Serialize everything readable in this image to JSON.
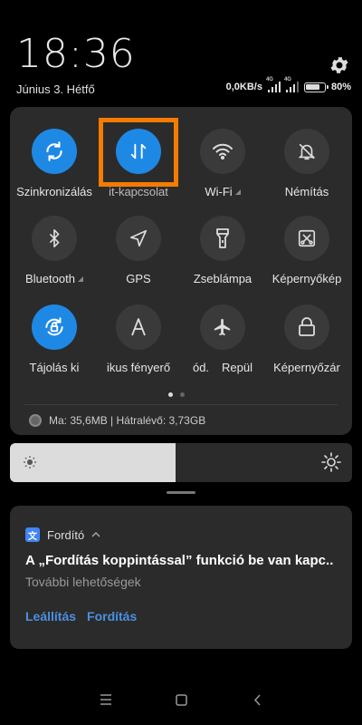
{
  "status": {
    "time": "18:36",
    "date": "Június 3. Hétfő",
    "net_speed": "0,0KB/s",
    "sim1_type": "4G",
    "sim2_type": "4G",
    "battery": "80%",
    "battery_level": 0.8
  },
  "quick_settings": {
    "tiles": [
      {
        "label": "Szinkronizálás",
        "icon": "sync-icon",
        "active": true,
        "expandable": false
      },
      {
        "label": "it-kapcsolat",
        "icon": "mobile-data-icon",
        "active": true,
        "expandable": false
      },
      {
        "label": "Wi-Fi",
        "icon": "wifi-icon",
        "active": false,
        "expandable": true
      },
      {
        "label": "Némítás",
        "icon": "mute-icon",
        "active": false,
        "expandable": false
      },
      {
        "label": "Bluetooth",
        "icon": "bluetooth-icon",
        "active": false,
        "expandable": true
      },
      {
        "label": "GPS",
        "icon": "gps-icon",
        "active": false,
        "expandable": false
      },
      {
        "label": "Zseblámpa",
        "icon": "flashlight-icon",
        "active": false,
        "expandable": false
      },
      {
        "label": "Képernyőkép",
        "icon": "screenshot-icon",
        "active": false,
        "expandable": false
      },
      {
        "label": "Tájolás ki",
        "icon": "rotation-lock-icon",
        "active": true,
        "expandable": false
      },
      {
        "label": "ikus fényerő",
        "icon": "auto-brightness-icon",
        "active": false,
        "expandable": false
      },
      {
        "label": "ód.",
        "icon": "airplane-icon",
        "active": false,
        "expandable": false
      },
      {
        "label": "Képernyőzár",
        "icon": "lock-icon",
        "active": false,
        "expandable": false
      }
    ],
    "extra_label_repul": "Repül",
    "page_count": 2,
    "current_page": 1,
    "memory_text": "Ma: 35,6MB | Hátralévő: 3,73GB"
  },
  "brightness": {
    "level": 0.485
  },
  "notification": {
    "app_name": "Fordító",
    "title": "A „Fordítás koppintással” funkció be van kapc..",
    "subtitle": "További lehetőségek",
    "action_stop": "Leállítás",
    "action_translate": "Fordítás"
  },
  "colors": {
    "accent": "#1e88e5",
    "highlight": "#f57c00",
    "link": "#4a90e2",
    "panel": "#2b2b2b"
  }
}
